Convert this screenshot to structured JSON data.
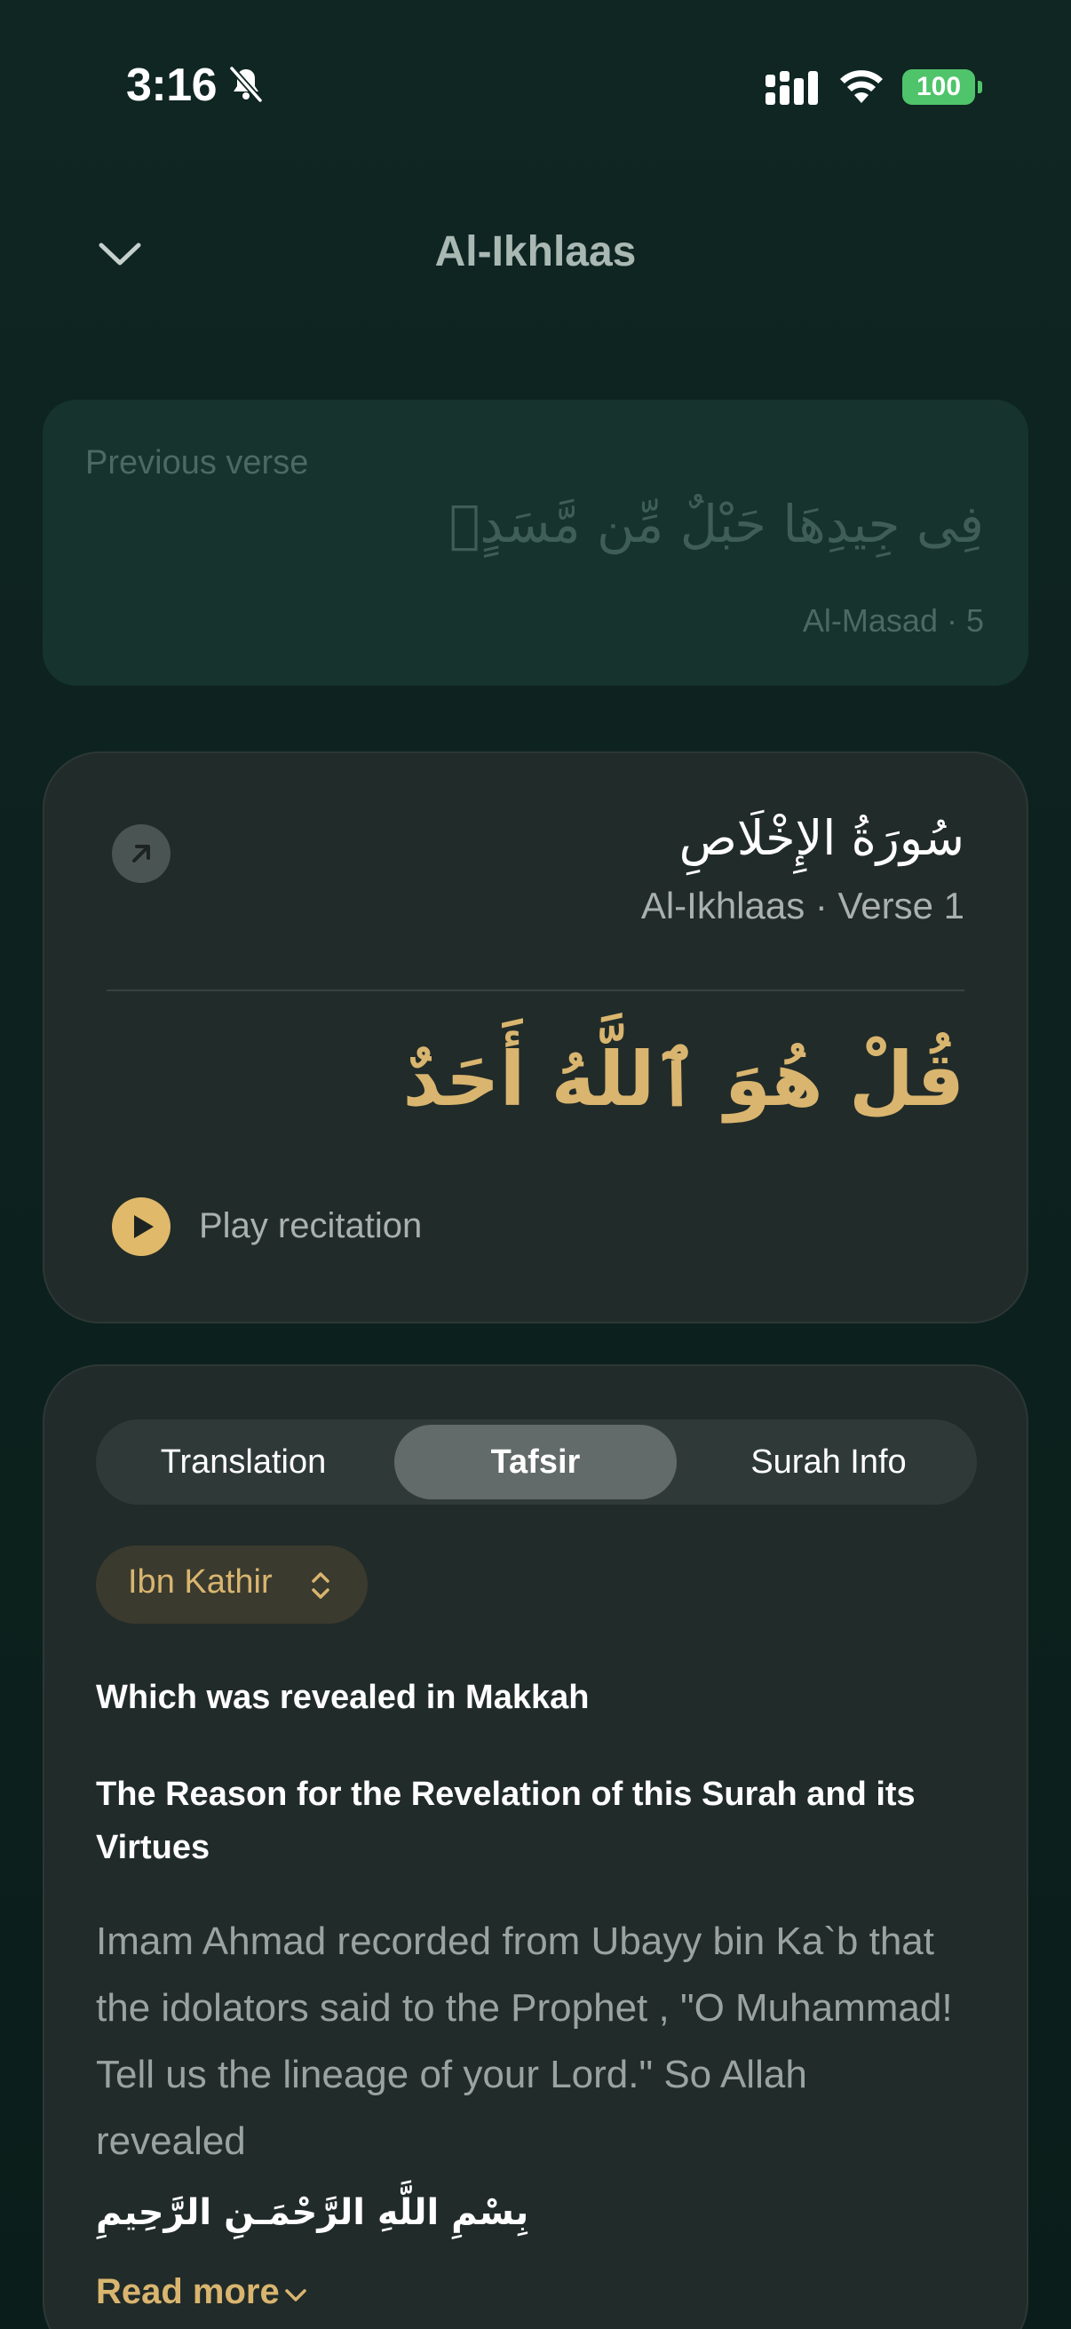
{
  "status_bar": {
    "time": "3:16",
    "battery": "100",
    "icons": [
      "bell-slash-icon",
      "cellular-signal-icon",
      "wifi-icon",
      "battery-icon"
    ]
  },
  "header": {
    "title": "Al-Ikhlaas",
    "collapse_icon": "chevron-down-icon"
  },
  "previous_verse": {
    "label": "Previous verse",
    "arabic": "فِى جِيدِهَا حَبْلٌ مِّن مَّسَدٍۭ",
    "reference": "Al-Masad · 5"
  },
  "verse": {
    "surah_arabic": "سُورَةُ الإِخْلَاصِ",
    "reference": "Al-Ikhlaas · Verse 1",
    "arabic": "قُلْ هُوَ ٱللَّهُ أَحَدٌ",
    "play_label": "Play recitation",
    "open_icon": "arrow-up-right-icon",
    "play_icon": "play-icon"
  },
  "tabs": [
    {
      "label": "Translation",
      "selected": false
    },
    {
      "label": "Tafsir",
      "selected": true
    },
    {
      "label": "Surah Info",
      "selected": false
    }
  ],
  "tafsir": {
    "source": "Ibn Kathir",
    "heading1": "Which was revealed in Makkah",
    "heading2": "The Reason for the Revelation of this Surah and its Virtues",
    "body": "Imam Ahmad recorded from Ubayy bin Ka`b that the idolators said to the Prophet , \"O Muhammad! Tell us the lineage of your Lord.\" So Allah revealed",
    "bismillah": "بِسْمِ اللَّهِ الرَّحْمَـنِ الرَّحِيمِ",
    "read_more": "Read more"
  },
  "colors": {
    "background": "#0d221e",
    "accent_gold": "#d9b56f",
    "card": "#212b29",
    "prev_card": "#16332e",
    "battery_green": "#4fc46a"
  }
}
